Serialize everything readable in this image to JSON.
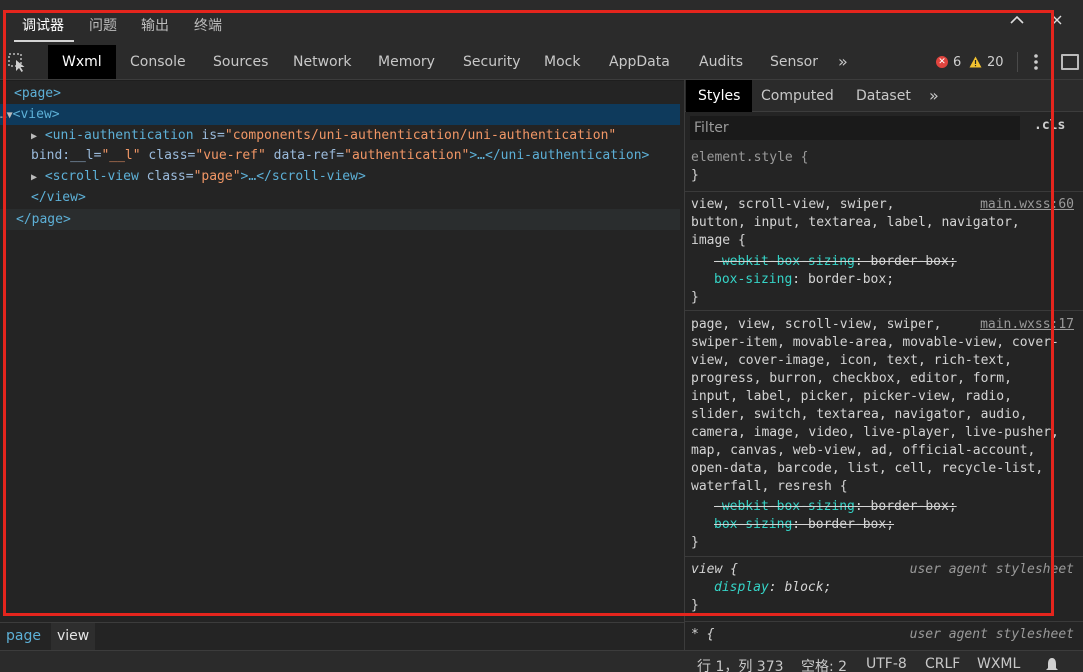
{
  "top_tabs": [
    "调试器",
    "问题",
    "输出",
    "终端"
  ],
  "devtools_tabs": [
    "Wxml",
    "Console",
    "Sources",
    "Network",
    "Memory",
    "Security",
    "Mock",
    "AppData",
    "Audits",
    "Sensor"
  ],
  "more_symbol": "»",
  "counts": {
    "errors": "6",
    "warnings": "20"
  },
  "elements": {
    "page_open": "<page>",
    "view_open": "<view>",
    "uni_tag_open": "<uni-authentication",
    "uni_is_attr": "is=",
    "uni_is_val": "\"components/uni-authentication/uni-authentication\"",
    "uni_bind_attr": "bind:__l=",
    "uni_bind_val": "\"__l\"",
    "uni_class_attr": "class=",
    "uni_class_val": "\"vue-ref\"",
    "uni_dataref_attr": "data-ref=",
    "uni_dataref_val": "\"authentication\"",
    "uni_tail": ">…</uni-authentication>",
    "scroll_tag_open": "<scroll-view",
    "scroll_class_attr": "class=",
    "scroll_class_val": "\"page\"",
    "scroll_tail": ">…</scroll-view>",
    "view_close": "</view>",
    "page_close": "</page>"
  },
  "breadcrumbs": [
    "page",
    "view"
  ],
  "styles_tabs": [
    "Styles",
    "Computed",
    "Dataset"
  ],
  "filter": {
    "placeholder": "Filter"
  },
  "cls_label": ".cls",
  "rules": {
    "element_style": {
      "selector": "element.style {",
      "close": "}"
    },
    "r1": {
      "selector": "view, scroll-view, swiper,\nbutton, input, textarea, label, navigator,\nimage {",
      "source": "main.wxss:60",
      "props": [
        {
          "name": "-webkit-box-sizing",
          "value": "border-box;"
        },
        {
          "name": "box-sizing",
          "value": "border-box;"
        }
      ],
      "close": "}"
    },
    "r2": {
      "selector": "page, view, scroll-view, swiper,\nswiper-item, movable-area, movable-view, cover-\nview, cover-image, icon, text, rich-text,\nprogress, burron, checkbox, editor, form,\ninput, label, picker, picker-view, radio,\nslider, switch, textarea, navigator, audio,\ncamera, image, video, live-player, live-pusher,\nmap, canvas, web-view, ad, official-account,\nopen-data, barcode, list, cell, recycle-list,\nwaterfall, resresh {",
      "source": "main.wxss:17",
      "props": [
        {
          "name": "-webkit-box-sizing",
          "value": "border-box;"
        },
        {
          "name": "box-sizing",
          "value": "border-box;"
        }
      ],
      "close": "}"
    },
    "r3": {
      "selector": "view {",
      "source": "user agent stylesheet",
      "props": [
        {
          "name": "display",
          "value": "block;"
        }
      ],
      "close": "}"
    },
    "r4": {
      "selector": "* {",
      "source": "user agent stylesheet"
    }
  },
  "status": {
    "position": "行 1，列 373",
    "spaces": "空格: 2",
    "encoding": "UTF-8",
    "eol": "CRLF",
    "language": "WXML"
  },
  "colors": {
    "annotation": "#e5251d",
    "selected_row": "#0e3a5c",
    "tag": "#5db0d7",
    "attr_value": "#f29766",
    "css_prop": "#35d4c7"
  },
  "icons": [
    "chevron-up-icon",
    "close-icon",
    "inspect-element-icon",
    "error-icon",
    "warning-icon",
    "more-vertical-icon",
    "dock-icon",
    "bell-icon"
  ]
}
